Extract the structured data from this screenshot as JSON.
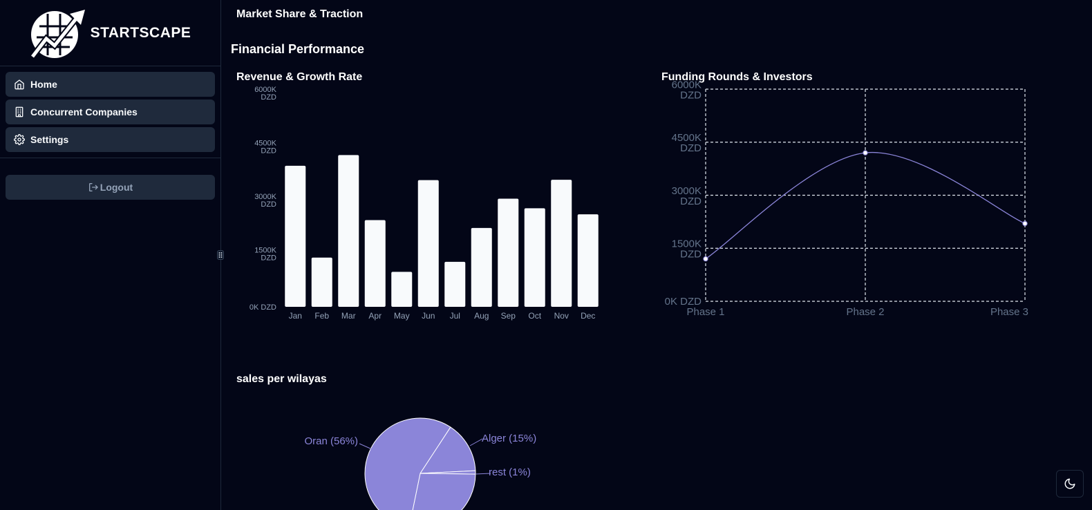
{
  "brand": {
    "name": "STARTSCAPE"
  },
  "sidebar": {
    "items": [
      {
        "label": "Home",
        "icon": "home-icon"
      },
      {
        "label": "Concurrent Companies",
        "icon": "building-icon"
      },
      {
        "label": "Settings",
        "icon": "gear-icon"
      }
    ],
    "logout_label": "Logout"
  },
  "main": {
    "market_title": "Market Share & Traction",
    "section_title": "Financial Performance",
    "revenue_title": "Revenue & Growth Rate",
    "funding_title": "Funding Rounds & Investors",
    "sales_title": "sales per wilayas"
  },
  "colors": {
    "background": "#030617",
    "bar": "#f8fafc",
    "accent": "#8b85d9",
    "nav_bg": "#1f2a3c"
  },
  "chart_data": [
    {
      "type": "bar",
      "title": "Revenue & Growth Rate",
      "categories": [
        "Jan",
        "Feb",
        "Mar",
        "Apr",
        "May",
        "Jun",
        "Jul",
        "Aug",
        "Sep",
        "Oct",
        "Nov",
        "Dec"
      ],
      "values": [
        3950,
        1380,
        4250,
        2430,
        980,
        3550,
        1260,
        2210,
        3030,
        2760,
        3560,
        2590
      ],
      "ylim": [
        0,
        6000
      ],
      "yticks": [
        "0K DZD",
        "1500K DZD",
        "3000K DZD",
        "4500K DZD",
        "6000K DZD"
      ],
      "grid": false
    },
    {
      "type": "line",
      "title": "Funding Rounds & Investors",
      "categories": [
        "Phase 1",
        "Phase 2",
        "Phase 3"
      ],
      "values": [
        1200,
        4200,
        2200
      ],
      "ylim": [
        0,
        6000
      ],
      "yticks": [
        "0K DZD",
        "1500K DZD",
        "3000K DZD",
        "4500K DZD",
        "6000K DZD"
      ],
      "grid": true
    },
    {
      "type": "pie",
      "title": "sales per wilayas",
      "labels": [
        "Oran (56%)",
        "Alger (15%)",
        "rest (1%)"
      ],
      "values": [
        56,
        15,
        1,
        28
      ]
    }
  ]
}
